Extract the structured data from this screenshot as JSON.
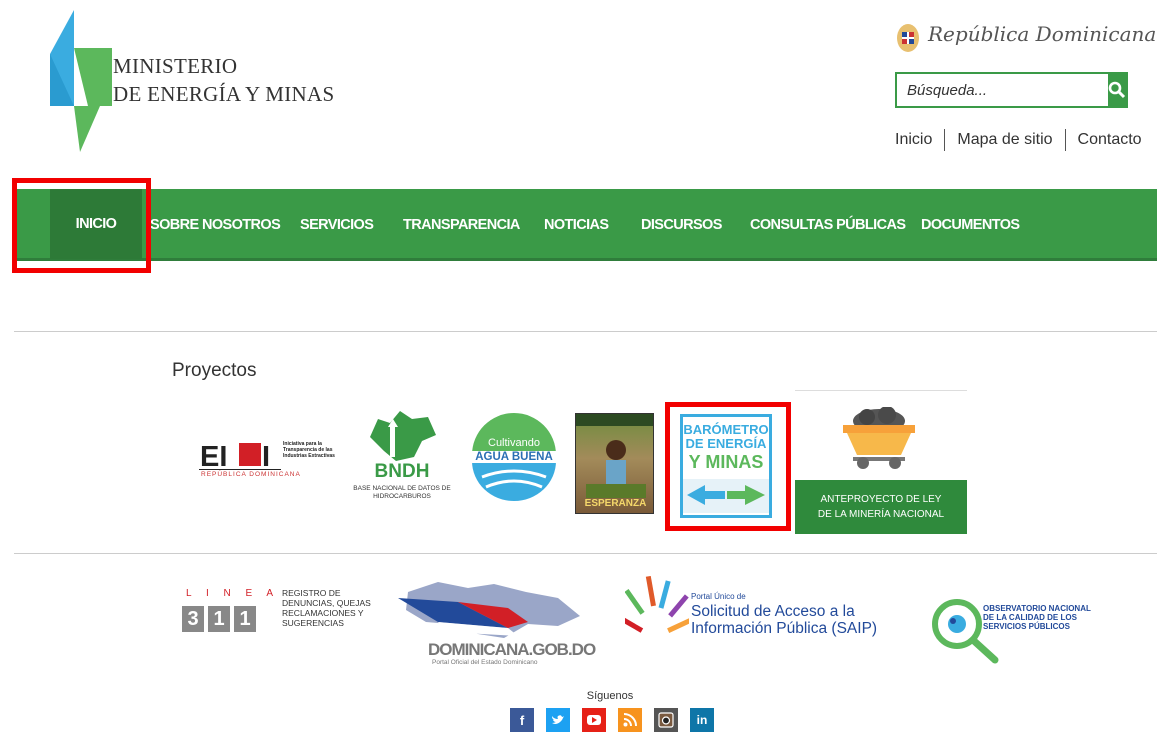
{
  "header": {
    "org_line1": "MINISTERIO",
    "org_line2": "DE ENERGÍA Y MINAS",
    "country": "República Dominicana",
    "search_placeholder": "Búsqueda...",
    "top_links": [
      "Inicio",
      "Mapa de sitio",
      "Contacto"
    ]
  },
  "nav": {
    "items": [
      "INICIO",
      "SOBRE NOSOTROS",
      "SERVICIOS",
      "TRANSPARENCIA",
      "NOTICIAS",
      "DISCURSOS",
      "CONSULTAS PÚBLICAS",
      "DOCUMENTOS"
    ],
    "active": "INICIO"
  },
  "projects": {
    "title": "Proyectos",
    "eiti": {
      "name": "EITI",
      "desc": "Iniciativa para la Transparencia de las Industrias Extractivas",
      "sub": "REPÚBLICA DOMINICANA"
    },
    "bndh": {
      "name": "BNDH",
      "sub": "BASE NACIONAL DE DATOS DE HIDROCARBUROS"
    },
    "agua": {
      "line1": "Cultivando",
      "line2": "AGUA BUENA"
    },
    "esperanza": {
      "label": "ESPERANZA"
    },
    "barometro": {
      "line1": "BARÓMETRO",
      "line2": "DE ENERGÍA",
      "line3": "Y MINAS"
    },
    "anteproyecto": {
      "line1": "ANTEPROYECTO DE LEY",
      "line2": "DE LA MINERÍA NACIONAL"
    }
  },
  "partners": {
    "linea": {
      "letters": "L I N E A",
      "number": "311",
      "text": [
        "REGISTRO DE",
        "DENUNCIAS, QUEJAS",
        "RECLAMACIONES Y",
        "SUGERENCIAS"
      ]
    },
    "dominicana": {
      "name": "DOMINICANA.GOB.DO",
      "sub": "Portal Oficial del Estado Dominicano"
    },
    "saip": {
      "small": "Portal Único de",
      "line1": "Solicitud de Acceso a la",
      "line2": "Información Pública (SAIP)"
    },
    "observatorio": {
      "lines": [
        "OBSERVATORIO NACIONAL",
        "DE LA CALIDAD DE LOS",
        "SERVICIOS PÚBLICOS"
      ]
    }
  },
  "social": {
    "label": "Síguenos",
    "icons": [
      "facebook-icon",
      "twitter-icon",
      "youtube-icon",
      "rss-icon",
      "instagram-icon",
      "linkedin-icon"
    ],
    "colors": {
      "facebook": "#3b5998",
      "twitter": "#1da1f2",
      "youtube": "#e62117",
      "rss": "#f7931e",
      "instagram": "#555555",
      "linkedin": "#0e76a8"
    }
  },
  "colors": {
    "brand_green": "#3a9a47",
    "nav_active": "#2d7a37",
    "highlight_red": "#f20000"
  }
}
